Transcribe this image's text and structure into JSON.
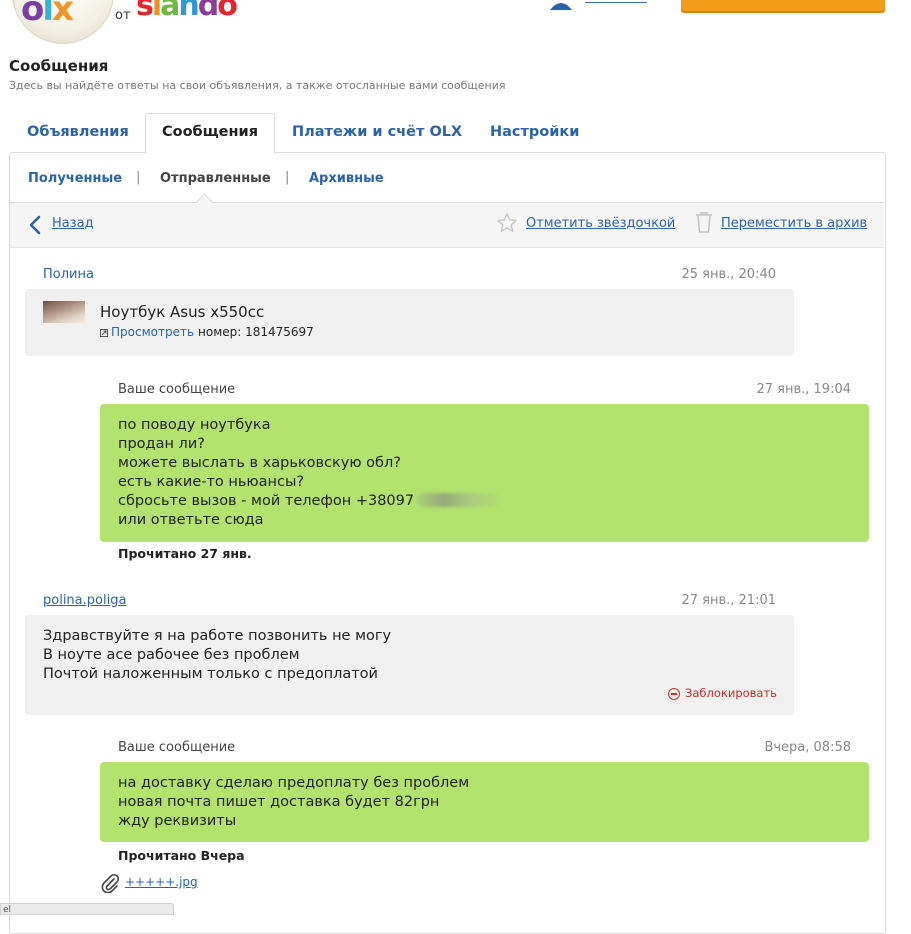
{
  "header": {
    "logo_from": "от",
    "brand_slando": [
      "s",
      "l",
      "a",
      "n",
      "d",
      "o"
    ]
  },
  "page": {
    "title": "Сообщения",
    "subtitle": "Здесь вы найдёте ответы на свои объявления, а также отосланные вами сообщения"
  },
  "tabs": [
    {
      "label": "Объявления"
    },
    {
      "label": "Сообщения"
    },
    {
      "label": "Платежи и счёт OLX"
    },
    {
      "label": "Настройки"
    }
  ],
  "subtabs": [
    {
      "label": "Полученные"
    },
    {
      "label": "Отправленные"
    },
    {
      "label": "Архивные"
    }
  ],
  "subtab_separator": "|",
  "toolbar": {
    "back": "Назад",
    "star": "Отметить звёздочкой",
    "archive": "Переместить в архив"
  },
  "thread": {
    "first": {
      "author": "Полина",
      "date": "25 янв., 20:40",
      "ad_title": "Ноутбук Asus x550cc",
      "ad_view": "Просмотреть",
      "ad_number": "номер: 181475697"
    },
    "msg1": {
      "label": "Ваше сообщение",
      "date": "27 янв., 19:04",
      "lines": [
        "по поводу ноутбука",
        "продан ли?",
        "можете выслать в харьковскую обл?",
        "есть какие-то ньюансы?",
        "сбросьте вызов - мой телефон +38097",
        "или ответьте сюда"
      ],
      "read": "Прочитано 27 янв."
    },
    "msg2": {
      "author": "polina.poliga",
      "date": "27 янв., 21:01",
      "lines": [
        "Здравствуйте я на работе позвонить не могу",
        "В ноуте асе рабочее без проблем",
        "Почтой наложенным только с предоплатой"
      ],
      "block": "Заблокировать"
    },
    "msg3": {
      "label": "Ваше сообщение",
      "date": "Вчера, 08:58",
      "lines": [
        "на доставку сделаю предоплату без проблем",
        "новая почта пишет доставка будет 82грн",
        "жду реквизиты"
      ],
      "read": "Прочитано Вчера",
      "attachment": "+++++.jpg"
    }
  },
  "bottom_bar": "el"
}
